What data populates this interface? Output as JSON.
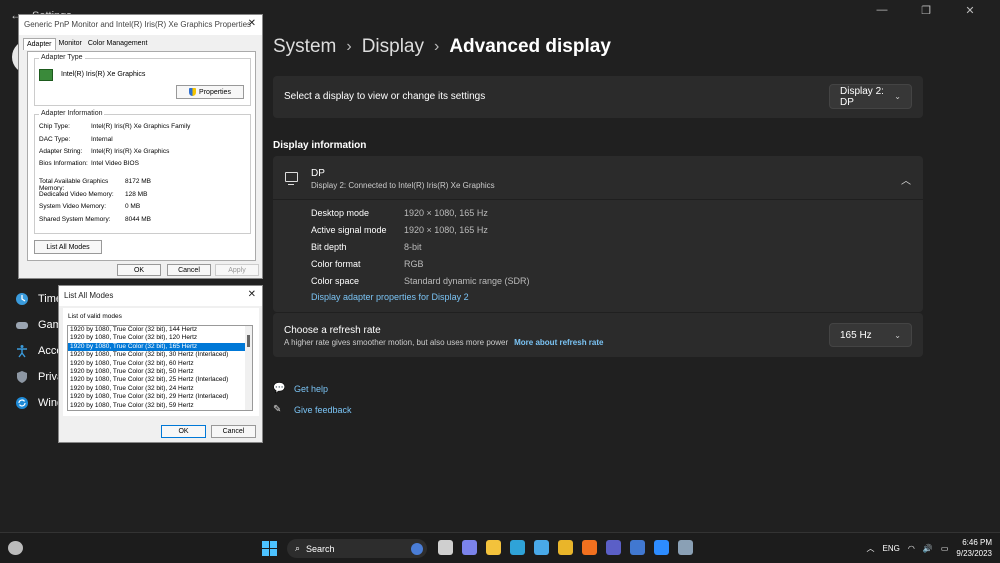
{
  "settings": {
    "app_title": "Settings",
    "window_controls": [
      "—",
      "❐",
      "✕"
    ],
    "nav": [
      {
        "label": "Time & language",
        "icon": "globe-clock-icon"
      },
      {
        "label": "Gaming",
        "icon": "gamepad-icon"
      },
      {
        "label": "Accessibility",
        "icon": "accessibility-icon"
      },
      {
        "label": "Privacy & security",
        "icon": "shield-icon"
      },
      {
        "label": "Windows Update",
        "icon": "sync-icon"
      }
    ],
    "breadcrumb": [
      "System",
      "Display",
      "Advanced display"
    ],
    "select_display": {
      "label": "Select a display to view or change its settings",
      "value": "Display 2: DP"
    },
    "section_title": "Display information",
    "display_info": {
      "name": "DP",
      "subtitle": "Display 2: Connected to Intel(R) Iris(R) Xe Graphics",
      "rows": [
        {
          "k": "Desktop mode",
          "v": "1920 × 1080, 165 Hz"
        },
        {
          "k": "Active signal mode",
          "v": "1920 × 1080, 165 Hz"
        },
        {
          "k": "Bit depth",
          "v": "8-bit"
        },
        {
          "k": "Color format",
          "v": "RGB"
        },
        {
          "k": "Color space",
          "v": "Standard dynamic range (SDR)"
        }
      ],
      "link": "Display adapter properties for Display 2"
    },
    "refresh": {
      "title": "Choose a refresh rate",
      "subtitle": "A higher rate gives smoother motion, but also uses more power",
      "link": "More about refresh rate",
      "value": "165 Hz"
    },
    "help": {
      "get_help": "Get help",
      "feedback": "Give feedback"
    }
  },
  "properties_dialog": {
    "title": "Generic PnP Monitor and Intel(R) Iris(R) Xe Graphics Properties",
    "tabs": [
      "Adapter",
      "Monitor",
      "Color Management"
    ],
    "adapter_type_label": "Adapter Type",
    "adapter_name": "Intel(R) Iris(R) Xe Graphics",
    "properties_button": "Properties",
    "adapter_info_label": "Adapter Information",
    "info": [
      {
        "k": "Chip Type:",
        "v": "Intel(R) Iris(R) Xe Graphics Family"
      },
      {
        "k": "DAC Type:",
        "v": "Internal"
      },
      {
        "k": "Adapter String:",
        "v": "Intel(R) Iris(R) Xe Graphics"
      },
      {
        "k": "Bios Information:",
        "v": "Intel Video BIOS"
      }
    ],
    "memory": [
      {
        "k": "Total Available Graphics Memory:",
        "v": "8172 MB"
      },
      {
        "k": "Dedicated Video Memory:",
        "v": "128 MB"
      },
      {
        "k": "System Video Memory:",
        "v": "0 MB"
      },
      {
        "k": "Shared System Memory:",
        "v": "8044 MB"
      }
    ],
    "list_all_modes_button": "List All Modes",
    "ok": "OK",
    "cancel": "Cancel",
    "apply": "Apply"
  },
  "modes_dialog": {
    "title": "List All Modes",
    "list_label": "List of valid modes",
    "modes": [
      "1920 by 1080, True Color (32 bit), 144 Hertz",
      "1920 by 1080, True Color (32 bit), 120 Hertz",
      "1920 by 1080, True Color (32 bit), 165 Hertz",
      "1920 by 1080, True Color (32 bit), 30 Hertz (Interlaced)",
      "1920 by 1080, True Color (32 bit), 60 Hertz",
      "1920 by 1080, True Color (32 bit), 50 Hertz",
      "1920 by 1080, True Color (32 bit), 25 Hertz (Interlaced)",
      "1920 by 1080, True Color (32 bit), 24 Hertz",
      "1920 by 1080, True Color (32 bit), 29 Hertz (Interlaced)",
      "1920 by 1080, True Color (32 bit), 59 Hertz"
    ],
    "selected_index": 2,
    "ok": "OK",
    "cancel": "Cancel"
  },
  "taskbar": {
    "search": "Search",
    "apps": [
      {
        "name": "task-view-icon",
        "color": "#cfcfcf"
      },
      {
        "name": "chat-icon",
        "color": "#7b83eb"
      },
      {
        "name": "file-explorer-icon",
        "color": "#f3c23c"
      },
      {
        "name": "edge-icon",
        "color": "#2fa3d8"
      },
      {
        "name": "store-icon",
        "color": "#49a9e8"
      },
      {
        "name": "chrome-icon",
        "color": "#e9b52a"
      },
      {
        "name": "firefox-icon",
        "color": "#f2701f"
      },
      {
        "name": "teams-icon",
        "color": "#5b5fc7"
      },
      {
        "name": "app-icon",
        "color": "#4178d1"
      },
      {
        "name": "zoom-icon",
        "color": "#2d8cff"
      },
      {
        "name": "settings-icon",
        "color": "#8aa0b5"
      }
    ],
    "lang": "ENG",
    "time": "6:46 PM",
    "date": "9/23/2023"
  }
}
